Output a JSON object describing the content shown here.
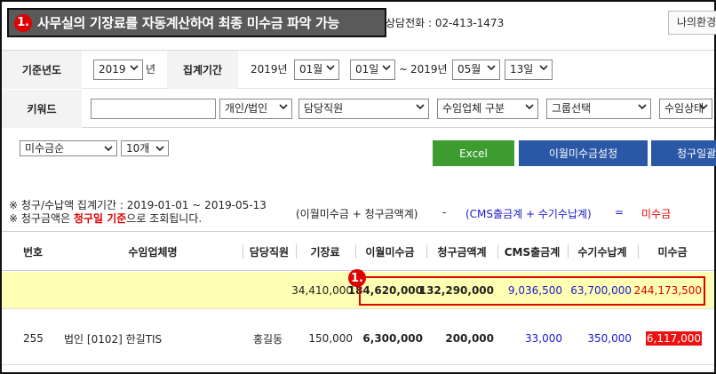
{
  "header": {
    "callout_badge": "1.",
    "callout_text": "사무실의 기장료를 자동계산하여 최종 미수금 파악 가능",
    "phone_label": "상담전화 : 02-413-1473",
    "myinfo_button": "나의환경"
  },
  "filters": {
    "base_year_label": "기준년도",
    "base_year_value": "2019",
    "year_suffix": "년",
    "period_label": "집계기간",
    "period_start_year": "2019년",
    "period_start_month": "01월",
    "period_start_day": "01일",
    "period_tilde": "~",
    "period_end_year": "2019년",
    "period_end_month": "05월",
    "period_end_day": "13일",
    "keyword_label": "키워드",
    "keyword_value": "",
    "type_select": "개인/법인",
    "staff_select": "담당직원",
    "company_type_select": "수임업체 구분",
    "group_select": "그룹선택",
    "status_select": "수임상태"
  },
  "sort": {
    "order_select": "미수금순",
    "count_select": "10개"
  },
  "buttons": {
    "excel": "Excel",
    "carryover": "이월미수금설정",
    "billing_date": "청구일괄"
  },
  "notes": {
    "line1": "※ 청구/수납액 집계기간 : 2019-01-01 ~ 2019-05-13",
    "line2_prefix": "※ 청구금액은 ",
    "line2_highlight": "청구일 기준",
    "line2_suffix": "으로 조회됩니다.",
    "formula_part1": "(이월미수금 + 청구금액계)",
    "formula_minus": "-",
    "formula_part2": "(CMS출금계 + 수기수납계)",
    "formula_equals": "=",
    "formula_result": "미수금"
  },
  "table": {
    "headers": [
      "번호",
      "수임업체명",
      "담당직원",
      "기장료",
      "이월미수금",
      "청구금액계",
      "CMS출금계",
      "수기수납계",
      "미수금"
    ],
    "total": {
      "fee": "34,410,000",
      "carryover": "184,620,000",
      "billed": "132,290,000",
      "cms": "9,036,500",
      "manual": "63,700,000",
      "unpaid": "244,173,500"
    },
    "total_badge": "1.",
    "rows": [
      {
        "no": "255",
        "company": "법인 [0102] 한길TIS",
        "staff": "홍길동",
        "fee": "150,000",
        "carryover": "6,300,000",
        "billed": "200,000",
        "cms": "33,000",
        "manual": "350,000",
        "unpaid": "6,117,000"
      }
    ]
  },
  "colors": {
    "callout_bg": "#5a5a5a",
    "badge_red": "#e10000",
    "excel_green": "#3d9c2f",
    "action_blue": "#2a57a6",
    "total_row_yellow": "#ffffb3",
    "amount_blue": "#1a1acc",
    "amount_red": "#e00000"
  },
  "icons": {
    "select_arrow": "chevron-down-icon"
  }
}
